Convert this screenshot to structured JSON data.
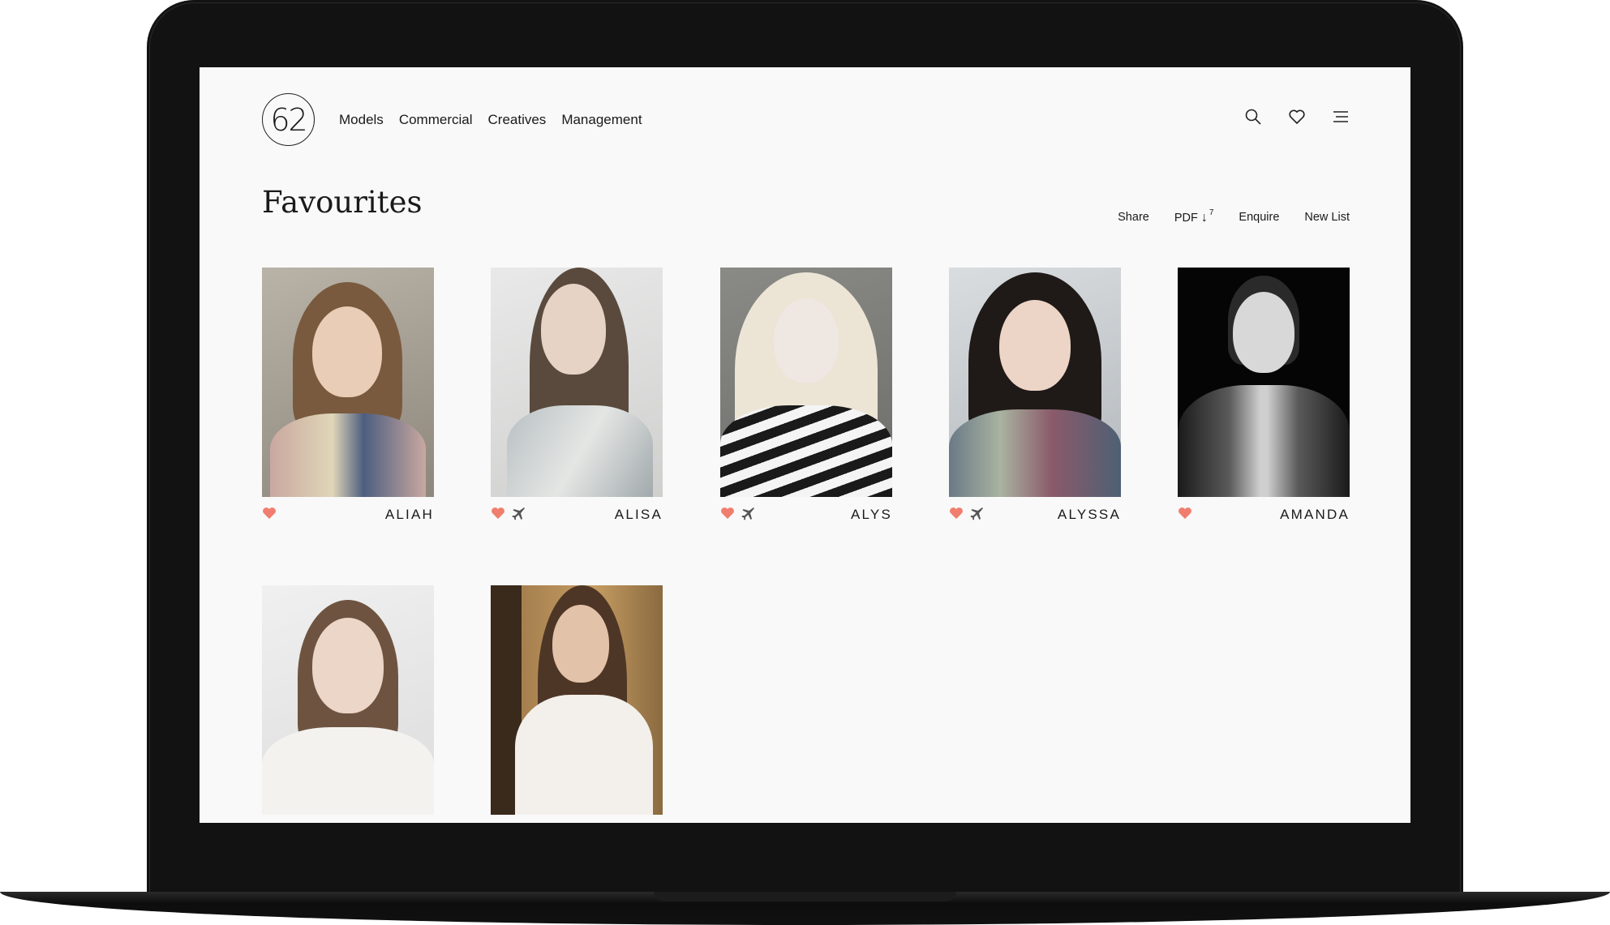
{
  "brand": {
    "logo_text": "62"
  },
  "nav": {
    "items": [
      "Models",
      "Commercial",
      "Creatives",
      "Management"
    ]
  },
  "header_icons": [
    "search-icon",
    "heart-icon",
    "menu-icon"
  ],
  "page": {
    "title": "Favourites"
  },
  "actions": {
    "share": "Share",
    "pdf": "PDF",
    "pdf_count": "7",
    "enquire": "Enquire",
    "new_list": "New List"
  },
  "colors": {
    "accent": "#f07e6e",
    "text": "#1a1a1a",
    "screen_bg": "#f9f9f9"
  },
  "models": [
    {
      "name": "ALIAH",
      "favourited": true,
      "travel": false
    },
    {
      "name": "ALISA",
      "favourited": true,
      "travel": true
    },
    {
      "name": "ALYS",
      "favourited": true,
      "travel": true
    },
    {
      "name": "ALYSSA",
      "favourited": true,
      "travel": true
    },
    {
      "name": "AMANDA",
      "favourited": true,
      "travel": false
    },
    {
      "name": "",
      "favourited": false,
      "travel": false
    },
    {
      "name": "",
      "favourited": false,
      "travel": false
    }
  ]
}
